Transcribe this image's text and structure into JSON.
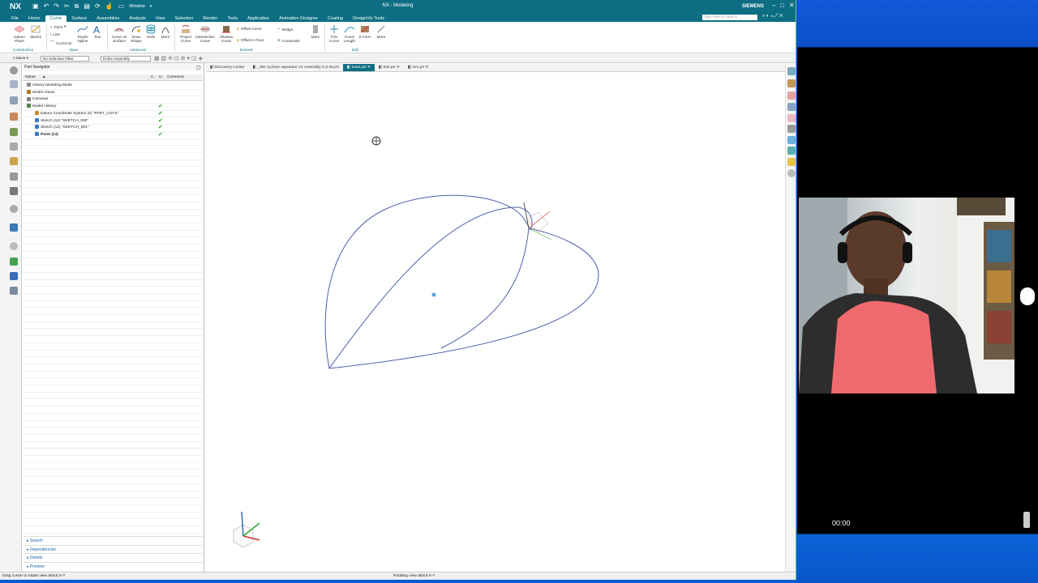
{
  "window": {
    "logo": "NX",
    "title": "NX - Modeling",
    "brand": "SIEMENS",
    "window_menu": "Window"
  },
  "menu": {
    "tabs": [
      "File",
      "Home",
      "Curve",
      "Surface",
      "Assemblies",
      "Analysis",
      "View",
      "Selection",
      "Render",
      "Tools",
      "Application",
      "Animation Designer",
      "Coating",
      "DesignViz Tools"
    ],
    "active": "Curve",
    "search_placeholder": "Type Here to Search"
  },
  "ribbon": {
    "datum_plane": "Datum Plane",
    "sketch": "Sketch",
    "point": "Point",
    "line": "Line",
    "arc_circle": "Arc/Circle",
    "studio_spline": "Studio Spline",
    "text": "Text",
    "curve_on_surface": "Curve on Surface",
    "draw_shape": "Draw Shape",
    "helix": "Helix",
    "more1": "More",
    "project_curve": "Project Curve",
    "intersection_curve": "Intersection Curve",
    "shadow_curve": "Shadow Curve",
    "offset_curve": "Offset Curve",
    "offset_in_face": "Offset in Face",
    "bridge": "Bridge",
    "composite": "Composite",
    "more2": "More",
    "trim_curve": "Trim Curve",
    "curve_length": "Curve Length",
    "x_form": "X-Form",
    "more3": "More",
    "group_construction": "Construction",
    "group_base": "Base",
    "group_advanced": "Advanced",
    "group_derived": "Derived",
    "group_edit": "Edit"
  },
  "selection_bar": {
    "menu": "Menu",
    "filter": "No Selection Filter",
    "scope": "Entire Assembly"
  },
  "part_navigator": {
    "title": "Part Navigator",
    "columns": {
      "name": "Name",
      "c": "C..",
      "u": "U..",
      "comment": "Comment"
    },
    "rows": [
      {
        "label": "History Modeling Mode",
        "indent": 1,
        "check": false,
        "bold": false,
        "color": "#8a8a8a"
      },
      {
        "label": "Model Views",
        "indent": 1,
        "check": false,
        "bold": false,
        "color": "#b07c28"
      },
      {
        "label": "Cameras",
        "indent": 1,
        "check": false,
        "bold": false,
        "color": "#7c7c7c"
      },
      {
        "label": "Model History",
        "indent": 1,
        "check": true,
        "bold": false,
        "color": "#4a8a3c"
      },
      {
        "label": "Datum Coordinate System (0) \"PART_CSYS\"",
        "indent": 3,
        "check": true,
        "bold": false,
        "color": "#c88a2a"
      },
      {
        "label": "Sketch (11) \"SKETCH_000\"",
        "indent": 3,
        "check": true,
        "bold": false,
        "color": "#3b76c2"
      },
      {
        "label": "Sketch (12) \"SKETCH_001\"",
        "indent": 3,
        "check": true,
        "bold": false,
        "color": "#3b76c2"
      },
      {
        "label": "Point (13)",
        "indent": 3,
        "check": true,
        "bold": true,
        "color": "#3b76c2"
      }
    ],
    "bottom_panels": [
      "Search",
      "Dependencies",
      "Details",
      "Preview"
    ]
  },
  "doc_tabs": [
    {
      "label": "Discovery Center",
      "active": false
    },
    {
      "label": "_8W cyclone separator V2 Assembly 2-3-25.prt",
      "active": false
    },
    {
      "label": "heart.prt",
      "active": true
    },
    {
      "label": "test.prt",
      "active": false
    },
    {
      "label": "lcm.prt",
      "active": false
    }
  ],
  "status": {
    "left": "Drag cursor to rotate view about X-Y",
    "center": "Rotating view about X-Y"
  },
  "webcam": {
    "timestamp": "00:00"
  },
  "colors": {
    "accent": "#0d6e83",
    "curve": "#4d5fa8",
    "check": "#2a9d2a"
  }
}
